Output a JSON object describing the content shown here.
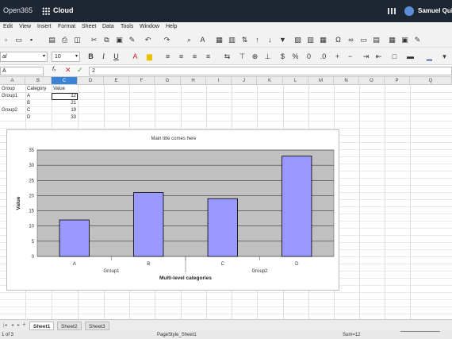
{
  "app": {
    "logo": "Open365",
    "cloud_label": "Cloud",
    "user": "Samuel Qui"
  },
  "menu": [
    "Edit",
    "View",
    "Insert",
    "Format",
    "Sheet",
    "Data",
    "Tools",
    "Window",
    "Help"
  ],
  "font": {
    "name": "al",
    "size": "10"
  },
  "formula_bar": {
    "name_box": "A",
    "fx": "fₓ",
    "value": "2"
  },
  "columns": [
    "A",
    "B",
    "C",
    "D",
    "E",
    "F",
    "G",
    "H",
    "I",
    "J",
    "K",
    "L",
    "M",
    "N",
    "O",
    "P",
    "Q"
  ],
  "selected_column": "C",
  "cells": [
    [
      "Group",
      "Category",
      "Value"
    ],
    [
      "Group1",
      "A",
      "12"
    ],
    [
      "",
      "B",
      "21"
    ],
    [
      "Group2",
      "C",
      "19"
    ],
    [
      "",
      "D",
      "33"
    ]
  ],
  "chart_data": {
    "type": "bar",
    "title": "Main title comes here",
    "xlabel": "Multi-level categories",
    "ylabel": "Value",
    "categories": [
      "A",
      "B",
      "C",
      "D"
    ],
    "groups": [
      "Group1",
      "Group2"
    ],
    "values": [
      12,
      21,
      19,
      33
    ],
    "ylim": [
      0,
      35
    ],
    "yticks": [
      0,
      5,
      10,
      15,
      20,
      25,
      30,
      35
    ],
    "grid": true,
    "colors": {
      "bar": "#9999ff",
      "plot_bg": "#c0c0c0"
    }
  },
  "tabs": [
    "Sheet1",
    "Sheet2",
    "Sheet3"
  ],
  "active_tab": "Sheet1",
  "status": {
    "sheet_count": "1 of 3",
    "page_style": "PageStyle_Sheet1",
    "sum": "Sum=12"
  }
}
